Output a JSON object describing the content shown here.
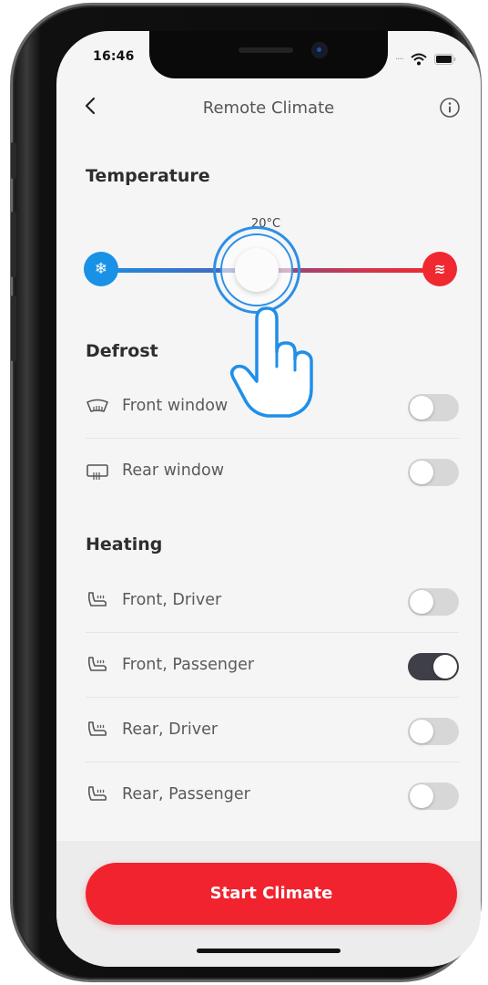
{
  "status_bar": {
    "time": "16:46"
  },
  "nav": {
    "title": "Remote Climate"
  },
  "temperature": {
    "title": "Temperature",
    "value_label": "20°C",
    "cold_icon": "snowflake-icon",
    "hot_icon": "heat-waves-icon",
    "slider_position": 0.46
  },
  "defrost": {
    "title": "Defrost",
    "items": [
      {
        "label": "Front window",
        "icon": "front-window-defrost-icon",
        "on": false
      },
      {
        "label": "Rear window",
        "icon": "rear-window-defrost-icon",
        "on": false
      }
    ]
  },
  "heating": {
    "title": "Heating",
    "items": [
      {
        "label": "Front, Driver",
        "icon": "seat-heat-icon",
        "on": false
      },
      {
        "label": "Front, Passenger",
        "icon": "seat-heat-icon",
        "on": true
      },
      {
        "label": "Rear, Driver",
        "icon": "seat-heat-icon",
        "on": false
      },
      {
        "label": "Rear, Passenger",
        "icon": "seat-heat-icon",
        "on": false
      }
    ]
  },
  "actions": {
    "start_label": "Start Climate"
  },
  "colors": {
    "accent_red": "#f0232e",
    "accent_blue": "#1891e6",
    "toggle_on": "#3e3f47"
  }
}
